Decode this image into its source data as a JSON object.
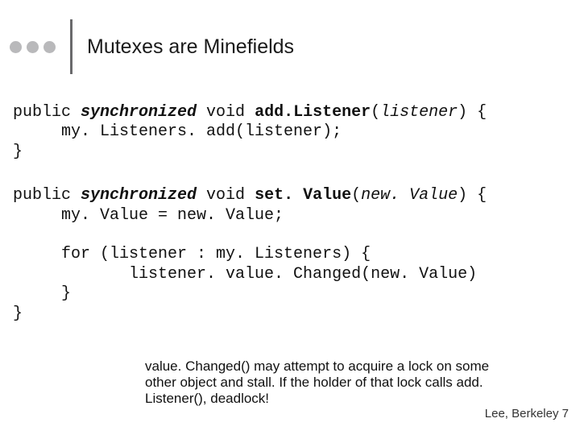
{
  "title": "Mutexes are Minefields",
  "code1": {
    "l1a": "public ",
    "l1b": "synchronized",
    "l1c": " void ",
    "l1d": "add.Listener",
    "l1e": "(",
    "l1f": "listener",
    "l1g": ") {",
    "l2": "     my. Listeners. add(listener);",
    "l3": "}"
  },
  "code2": {
    "l1a": "public ",
    "l1b": "synchronized",
    "l1c": " void ",
    "l1d": "set. Value",
    "l1e": "(",
    "l1f": "new. Value",
    "l1g": ") {",
    "l2": "     my. Value = new. Value;",
    "blank1": " ",
    "l3": "     for (listener : my. Listeners) {",
    "l4": "            listener. value. Changed(new. Value)",
    "l5": "     }",
    "l6": "}"
  },
  "note": "value. Changed() may attempt to acquire a lock on some other object and stall. If the holder of that lock calls add. Listener(), deadlock!",
  "footer": "Lee, Berkeley 7"
}
